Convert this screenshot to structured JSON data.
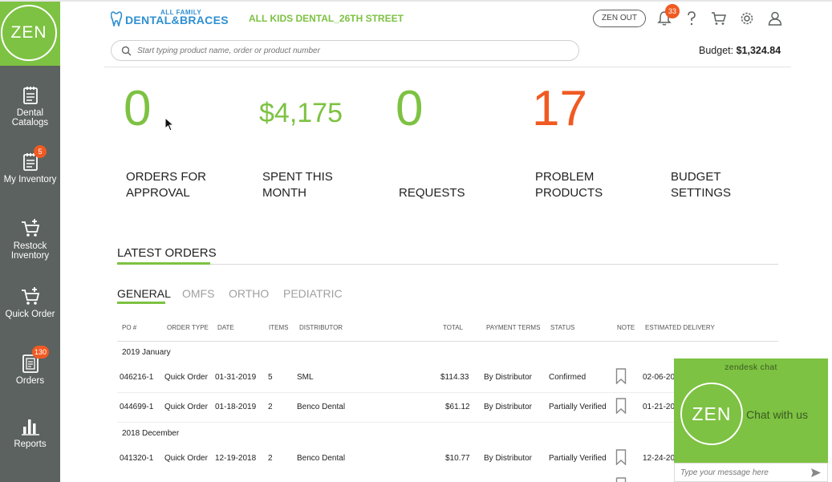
{
  "brand": {
    "small_text": "ALL FAMILY",
    "name": "DENTAL&BRACES",
    "logo_icon": "tooth-icon",
    "location": "ALL KIDS DENTAL_26TH STREET"
  },
  "header": {
    "zen_out_label": "ZEN OUT",
    "notifications_count": "33",
    "icons": [
      "bell-icon",
      "help-icon",
      "cart-icon",
      "gear-icon",
      "user-icon"
    ]
  },
  "search": {
    "placeholder": "Start typing product name, order or product number"
  },
  "budget": {
    "label": "Budget:",
    "value": "$1,324.84"
  },
  "sidebar": {
    "logo_text": "ZEN",
    "items": [
      {
        "label_line1": "Dental",
        "label_line2": "Catalogs",
        "icon": "catalog-icon",
        "badge": ""
      },
      {
        "label_line1": "My Inventory",
        "label_line2": "",
        "icon": "inventory-icon",
        "badge": "5"
      },
      {
        "label_line1": "Restock",
        "label_line2": "Inventory",
        "icon": "restock-cart-icon",
        "badge": ""
      },
      {
        "label_line1": "Quick Order",
        "label_line2": "",
        "icon": "quick-order-cart-icon",
        "badge": ""
      },
      {
        "label_line1": "Orders",
        "label_line2": "",
        "icon": "orders-icon",
        "badge": "130"
      },
      {
        "label_line1": "Reports",
        "label_line2": "",
        "icon": "reports-chart-icon",
        "badge": ""
      }
    ]
  },
  "stats": [
    {
      "value": "0",
      "label_line1": "ORDERS FOR",
      "label_line2": "APPROVAL",
      "color": "#7dc242"
    },
    {
      "value": "$4,175",
      "label_line1": "SPENT THIS",
      "label_line2": "MONTH",
      "color": "#7dc242"
    },
    {
      "value": "0",
      "label_line1": "",
      "label_line2": "REQUESTS",
      "color": "#7dc242"
    },
    {
      "value": "17",
      "label_line1": "PROBLEM",
      "label_line2": "PRODUCTS",
      "color": "#f05a22"
    },
    {
      "value": "",
      "label_line1": "BUDGET",
      "label_line2": "SETTINGS",
      "color": "#7dc242"
    }
  ],
  "latest_orders": {
    "title": "LATEST ORDERS",
    "tabs": [
      "GENERAL",
      "OMFS",
      "ORTHO",
      "PEDIATRIC"
    ],
    "active_tab": "GENERAL",
    "columns": [
      "PO #",
      "ORDER TYPE",
      "DATE",
      "ITEMS",
      "DISTRIBUTOR",
      "TOTAL",
      "PAYMENT TERMS",
      "STATUS",
      "NOTE",
      "ESTIMATED DELIVERY"
    ],
    "groups": [
      {
        "label": "2019 January",
        "rows": [
          {
            "po": "046216-1",
            "type": "Quick Order",
            "date": "01-31-2019",
            "items": "5",
            "distributor": "SML",
            "total": "$114.33",
            "terms": "By Distributor",
            "status": "Confirmed",
            "note_icon": "bookmark-icon",
            "delivery": "02-06-20"
          },
          {
            "po": "044699-1",
            "type": "Quick Order",
            "date": "01-18-2019",
            "items": "2",
            "distributor": "Benco Dental",
            "total": "$61.12",
            "terms": "By Distributor",
            "status": "Partially Verified",
            "note_icon": "bookmark-icon",
            "delivery": "01-21-20"
          }
        ]
      },
      {
        "label": "2018 December",
        "rows": [
          {
            "po": "041320-1",
            "type": "Quick Order",
            "date": "12-19-2018",
            "items": "2",
            "distributor": "Benco Dental",
            "total": "$10.77",
            "terms": "By Distributor",
            "status": "Partially Verified",
            "note_icon": "bookmark-icon",
            "delivery": "12-24-20"
          }
        ]
      }
    ]
  },
  "chat": {
    "header": "zendesk chat",
    "logo_text": "ZEN",
    "cta": "Chat with us",
    "input_placeholder": "Type your message here",
    "send_icon": "send-arrow-icon"
  },
  "colors": {
    "accent_green": "#7dc242",
    "alert_orange": "#f05a22",
    "sidebar_gray": "#5c6260",
    "brand_blue": "#2f8fd1"
  }
}
